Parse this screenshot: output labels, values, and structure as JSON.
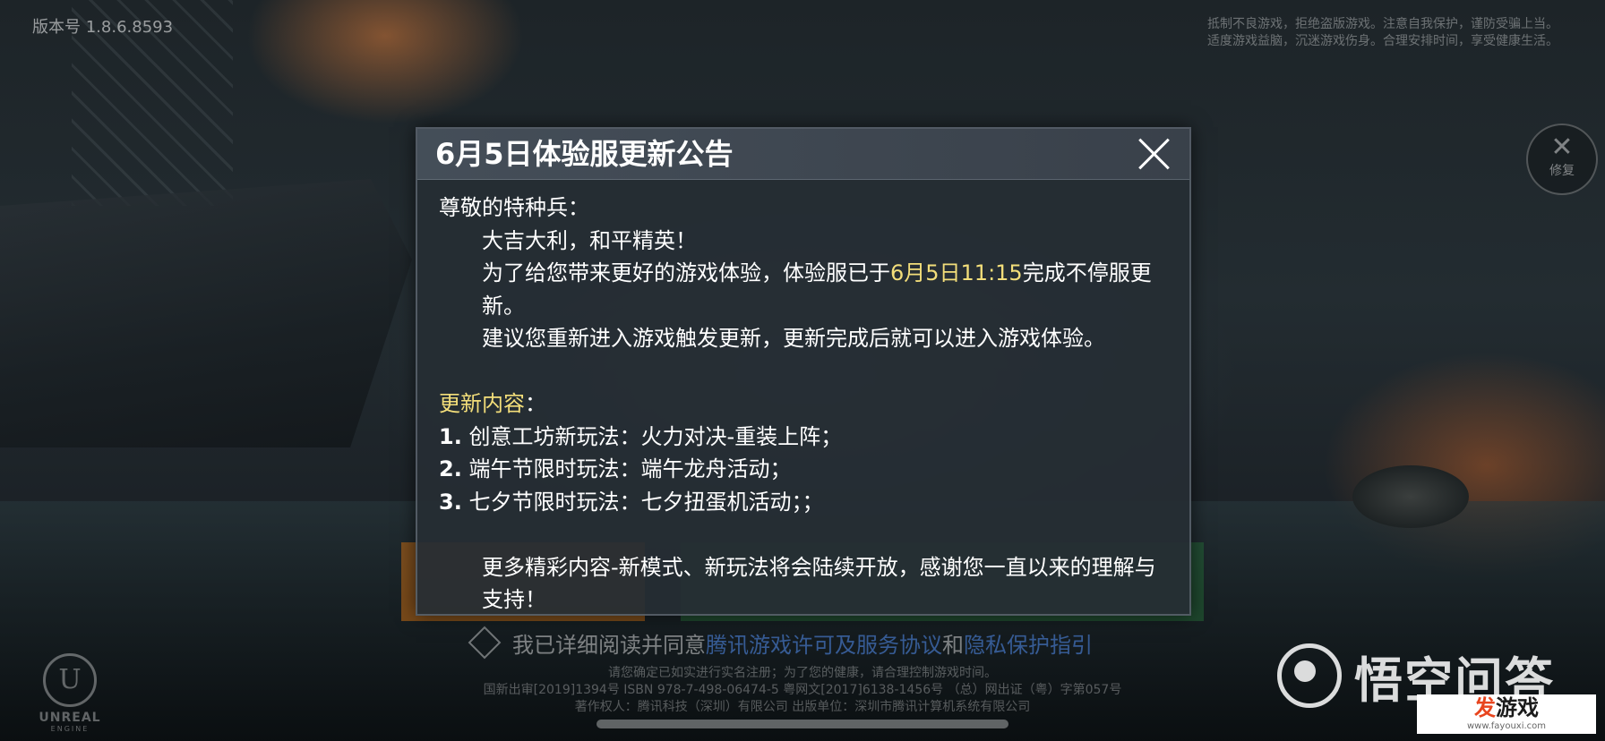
{
  "version": "版本号 1.8.6.8593",
  "health_notice": {
    "line1": "抵制不良游戏，拒绝盗版游戏。注意自我保护，谨防受骗上当。",
    "line2": "适度游戏益脑，沉迷游戏伤身。合理安排时间，享受健康生活。"
  },
  "repair": {
    "label": "修复",
    "icon": "wrench-screwdriver-icon"
  },
  "dialog": {
    "title": "6月5日体验服更新公告",
    "greeting": "尊敬的特种兵：",
    "blessing": "大吉大利，和平精英！",
    "para1_pre": "为了给您带来更好的游戏体验，体验服已于",
    "para1_time": "6月5日11:15",
    "para1_post": "完成不停服更新。",
    "para2": "建议您重新进入游戏触发更新，更新完成后就可以进入游戏体验。",
    "section_label": "更新内容",
    "section_colon": "：",
    "items": [
      {
        "num": "1.",
        "text": "创意工坊新玩法：火力对决-重装上阵；"
      },
      {
        "num": "2.",
        "text": "端午节限时玩法：端午龙舟活动；"
      },
      {
        "num": "3.",
        "text": "七夕节限时玩法：七夕扭蛋机活动；；"
      }
    ],
    "closing": "更多精彩内容-新模式、新玩法将会陆续开放，感谢您一直以来的理解与支持！"
  },
  "agreement": {
    "prefix": "我已详细阅读并同意",
    "link1": "腾讯游戏许可及服务协议",
    "and": "和",
    "link2": "隐私保护指引"
  },
  "legal": {
    "line1": "请您确定已如实进行实名注册；为了您的健康，请合理控制游戏时间。",
    "line2": "国新出审[2019]1394号  ISBN 978-7-498-06474-5  粤网文[2017]6138-1456号  （总）网出证（粤）字第057号",
    "line3": "著作权人：腾讯科技（深圳）有限公司  出版单位：深圳市腾讯计算机系统有限公司"
  },
  "engine_logo": {
    "text": "UNREAL",
    "sub": "ENGINE"
  },
  "watermark": {
    "wukong": "悟空问答",
    "fayouxi_a": "发",
    "fayouxi_b": "游戏",
    "fayouxi_url": "www.fayouxi.com"
  }
}
